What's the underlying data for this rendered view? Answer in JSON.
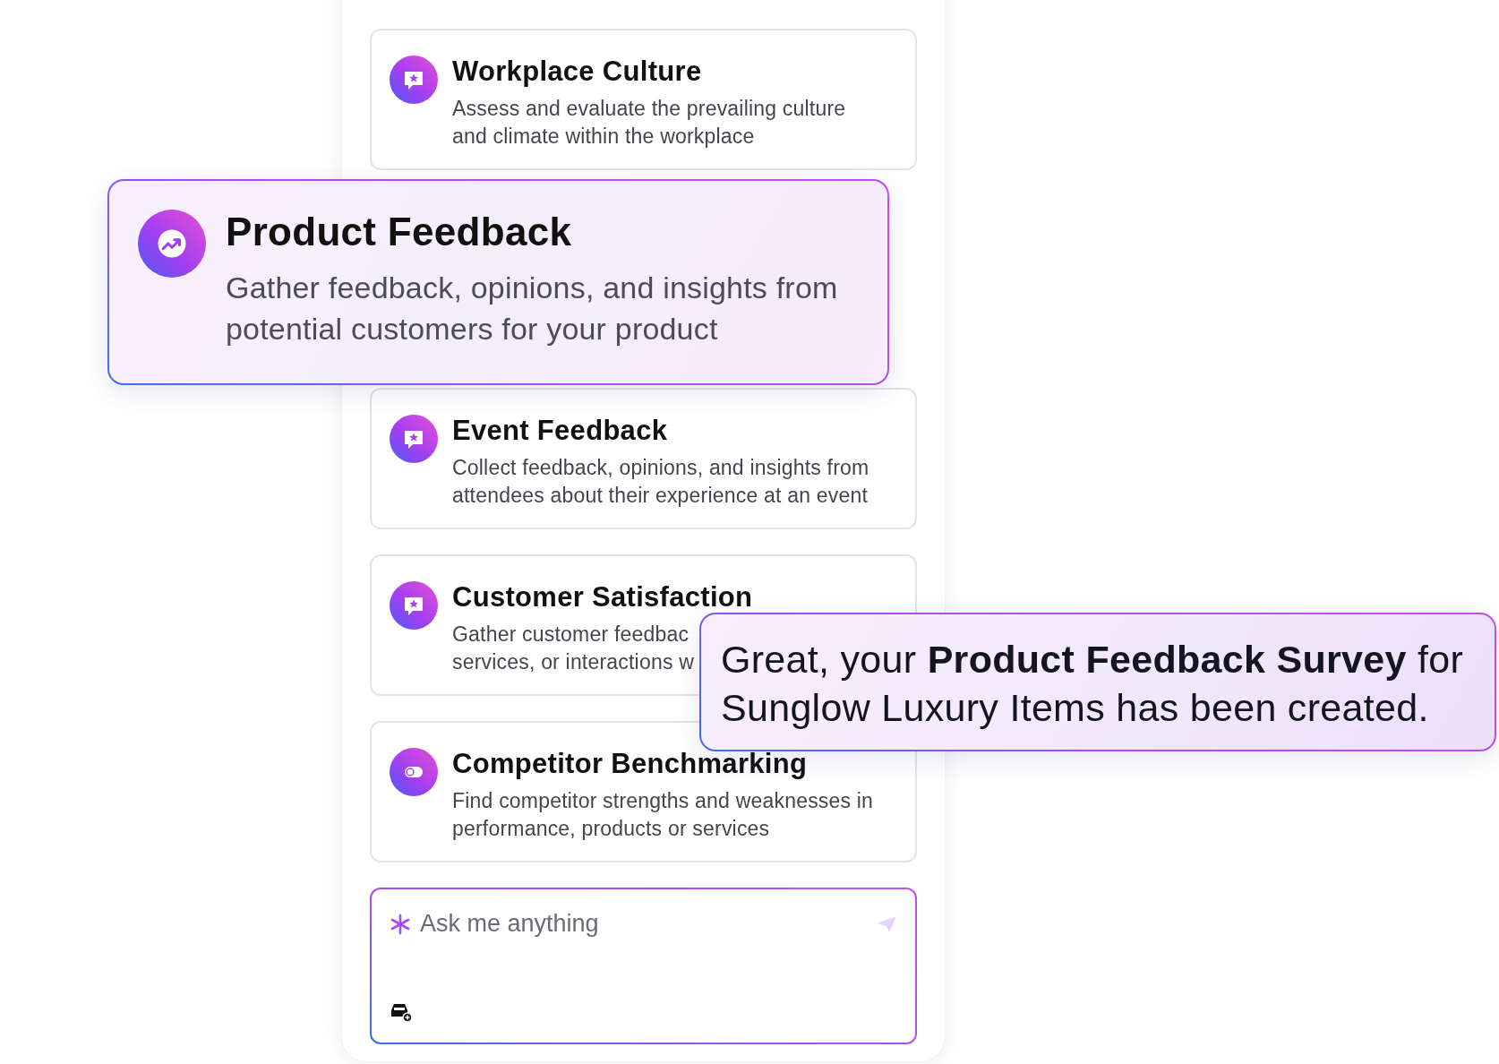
{
  "cards": [
    {
      "kind": "survey",
      "title": "Workplace Culture",
      "lines": [
        "Assess and evaluate the prevailing culture",
        "and climate within the workplace"
      ]
    },
    {
      "kind": "gap"
    },
    {
      "kind": "survey",
      "title": "Event Feedback",
      "lines": [
        "Collect feedback, opinions, and insights from",
        "attendees about their experience at an event"
      ]
    },
    {
      "kind": "survey",
      "title": "Customer Satisfaction",
      "lines": [
        "Gather customer feedbac",
        "services, or interactions w"
      ]
    },
    {
      "kind": "compare",
      "title": "Competitor Benchmarking",
      "lines": [
        "Find competitor strengths and weaknesses in",
        "performance, products or services"
      ]
    }
  ],
  "featured": {
    "kind": "trend",
    "title": "Product Feedback",
    "lines": [
      "Gather feedback, opinions, and insights from",
      "potential customers for your product"
    ]
  },
  "prompt": {
    "placeholder": "Ask me anything"
  },
  "toast": {
    "message": "Great, your **Product Feedback Survey** for Sunglow Luxury Items has been created."
  }
}
